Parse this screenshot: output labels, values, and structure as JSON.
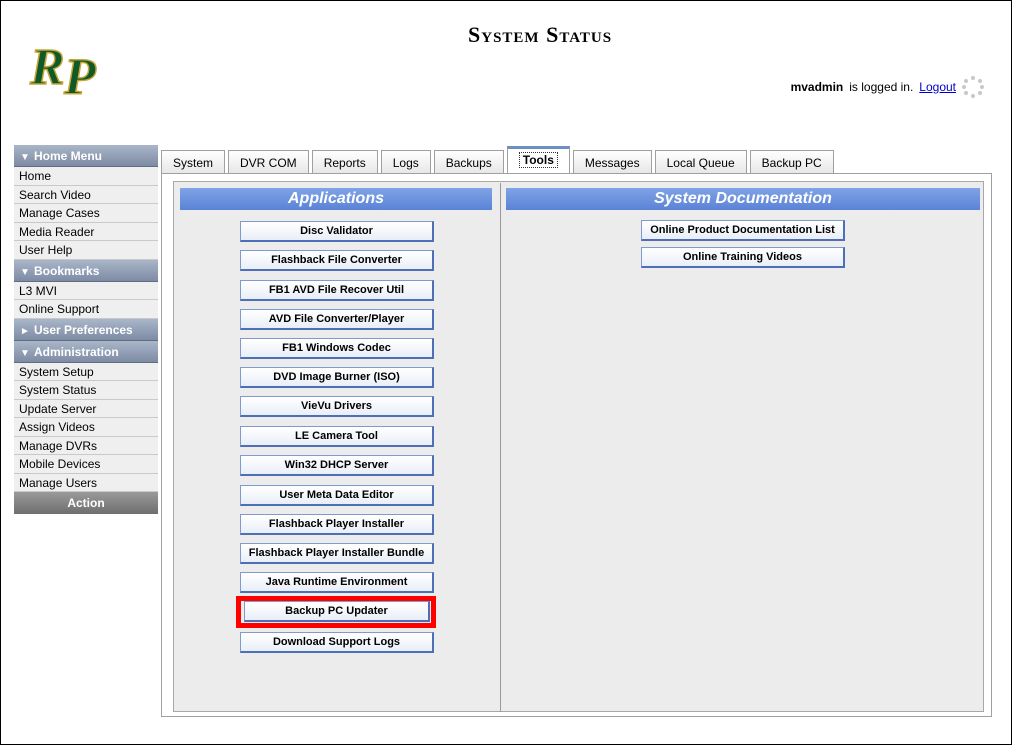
{
  "header": {
    "title": "System Status",
    "logo_text": "RP",
    "logged_user": "mvadmin",
    "logged_suffix": "is logged in.",
    "logout": "Logout"
  },
  "sidebar": {
    "home_menu": "Home Menu",
    "home_items": [
      "Home",
      "Search Video",
      "Manage Cases",
      "Media Reader",
      "User Help"
    ],
    "bookmarks": "Bookmarks",
    "bookmark_items": [
      "L3 MVI",
      "Online Support"
    ],
    "user_preferences": "User Preferences",
    "administration": "Administration",
    "admin_items": [
      "System Setup",
      "System Status",
      "Update Server",
      "Assign Videos",
      "Manage DVRs",
      "Mobile Devices",
      "Manage Users"
    ],
    "action": "Action"
  },
  "tabs": [
    "System",
    "DVR COM",
    "Reports",
    "Logs",
    "Backups",
    "Tools",
    "Messages",
    "Local Queue",
    "Backup PC"
  ],
  "active_tab": "Tools",
  "applications": {
    "title": "Applications",
    "buttons": [
      "Disc Validator",
      "Flashback File Converter",
      "FB1 AVD File Recover Util",
      "AVD File Converter/Player",
      "FB1 Windows Codec",
      "DVD Image Burner (ISO)",
      "VieVu Drivers",
      "LE Camera Tool",
      "Win32 DHCP Server",
      "User Meta Data Editor",
      "Flashback Player Installer",
      "Flashback Player Installer Bundle",
      "Java Runtime Environment",
      "Backup PC Updater",
      "Download Support Logs"
    ]
  },
  "documentation": {
    "title": "System Documentation",
    "buttons": [
      "Online Product Documentation List",
      "Online Training Videos"
    ]
  },
  "colors": {
    "section_header": "#5b83d6",
    "sidebar_header": "#7d8ba4",
    "highlight": "#ff0000"
  }
}
